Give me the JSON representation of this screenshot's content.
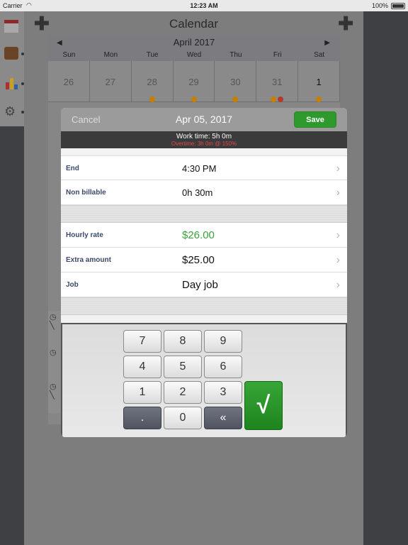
{
  "status_bar": {
    "carrier": "Carrier",
    "time": "12:23 AM",
    "battery": "100%"
  },
  "nav": {
    "title": "Calendar"
  },
  "calendar": {
    "month": "April 2017",
    "weekdays": [
      "Sun",
      "Mon",
      "Tue",
      "Wed",
      "Thu",
      "Fri",
      "Sat"
    ],
    "days": [
      {
        "num": "26",
        "dots": []
      },
      {
        "num": "27",
        "dots": []
      },
      {
        "num": "28",
        "dots": [
          "#c77f00"
        ]
      },
      {
        "num": "29",
        "dots": [
          "#c77f00"
        ]
      },
      {
        "num": "30",
        "dots": [
          "#c77f00"
        ]
      },
      {
        "num": "31",
        "dots": [
          "#c77f00",
          "#b33a2a"
        ]
      },
      {
        "num": "1",
        "dots": [
          "#c77f00"
        ]
      }
    ]
  },
  "modal": {
    "cancel_label": "Cancel",
    "title": "Apr 05, 2017",
    "save_label": "Save",
    "work_time": "Work time: 5h 0m",
    "overtime": "Overtime: 3h 0m  @ 150%",
    "rows": [
      {
        "label": "End",
        "value": "4:30 PM"
      },
      {
        "label": "Non billable",
        "value": "0h 30m"
      },
      {
        "label": "Hourly rate",
        "value": "$26.00"
      },
      {
        "label": "Extra amount",
        "value": "$25.00"
      },
      {
        "label": "Job",
        "value": "Day job"
      }
    ]
  },
  "keypad": {
    "keys": [
      "7",
      "8",
      "9",
      "4",
      "5",
      "6",
      "1",
      "2",
      "3",
      ".",
      "0",
      "«"
    ],
    "confirm": "√"
  },
  "colors": {
    "accent_green": "#2e9a2e",
    "overtime_red": "#e24848",
    "rate_green": "#3aa03a"
  }
}
